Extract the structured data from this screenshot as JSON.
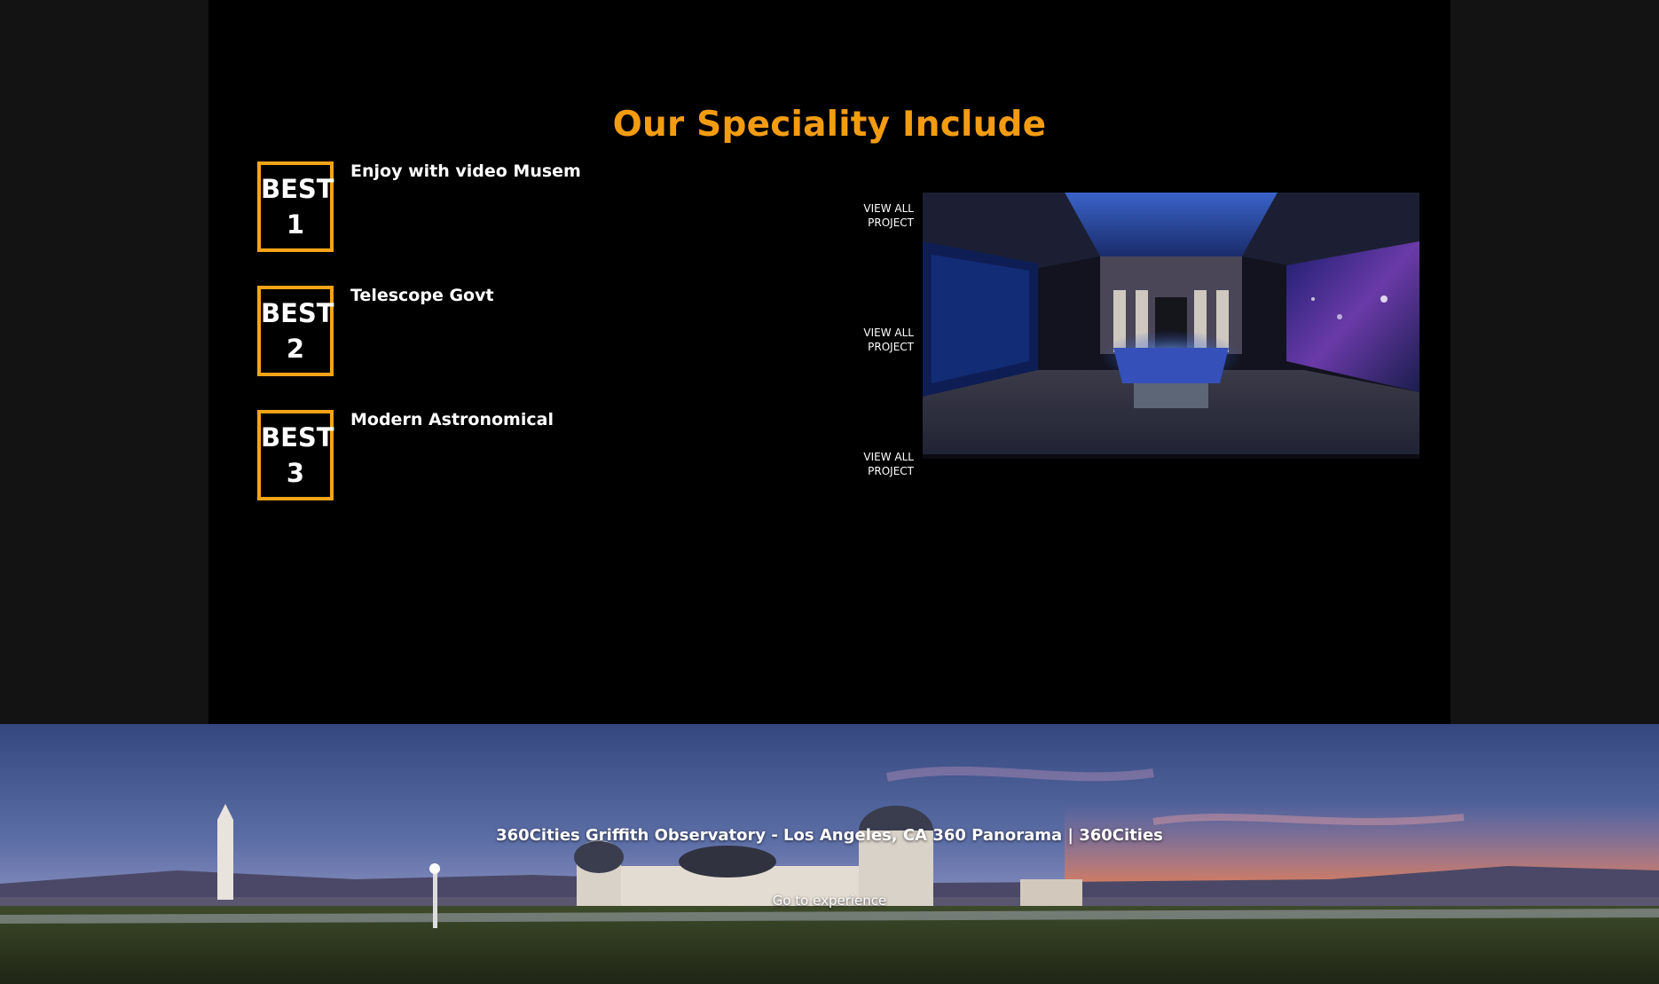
{
  "speciality": {
    "title": "Our Speciality Include",
    "items": [
      {
        "badge_word": "BEST",
        "badge_number": "1",
        "title": "Enjoy with video Musem",
        "link_line1": "VIEW ALL",
        "link_line2": "PROJECT"
      },
      {
        "badge_word": "BEST",
        "badge_number": "2",
        "title": "Telescope Govt",
        "link_line1": "VIEW ALL",
        "link_line2": "PROJECT"
      },
      {
        "badge_word": "BEST",
        "badge_number": "3",
        "title": "Modern Astronomical",
        "link_line1": "VIEW ALL",
        "link_line2": "PROJECT"
      }
    ],
    "image_subject": "observatory-exhibit-hall-photo"
  },
  "hero": {
    "title": "360Cities Griffith Observatory - Los Angeles, CA 360 Panorama | 360Cities",
    "link": "Go to experience",
    "image_subject": "griffith-observatory-panorama-photo"
  },
  "colors": {
    "accent": "#f39c12",
    "badge_border": "#f5a418",
    "panel_bg": "#000000",
    "page_bg": "#131313"
  }
}
